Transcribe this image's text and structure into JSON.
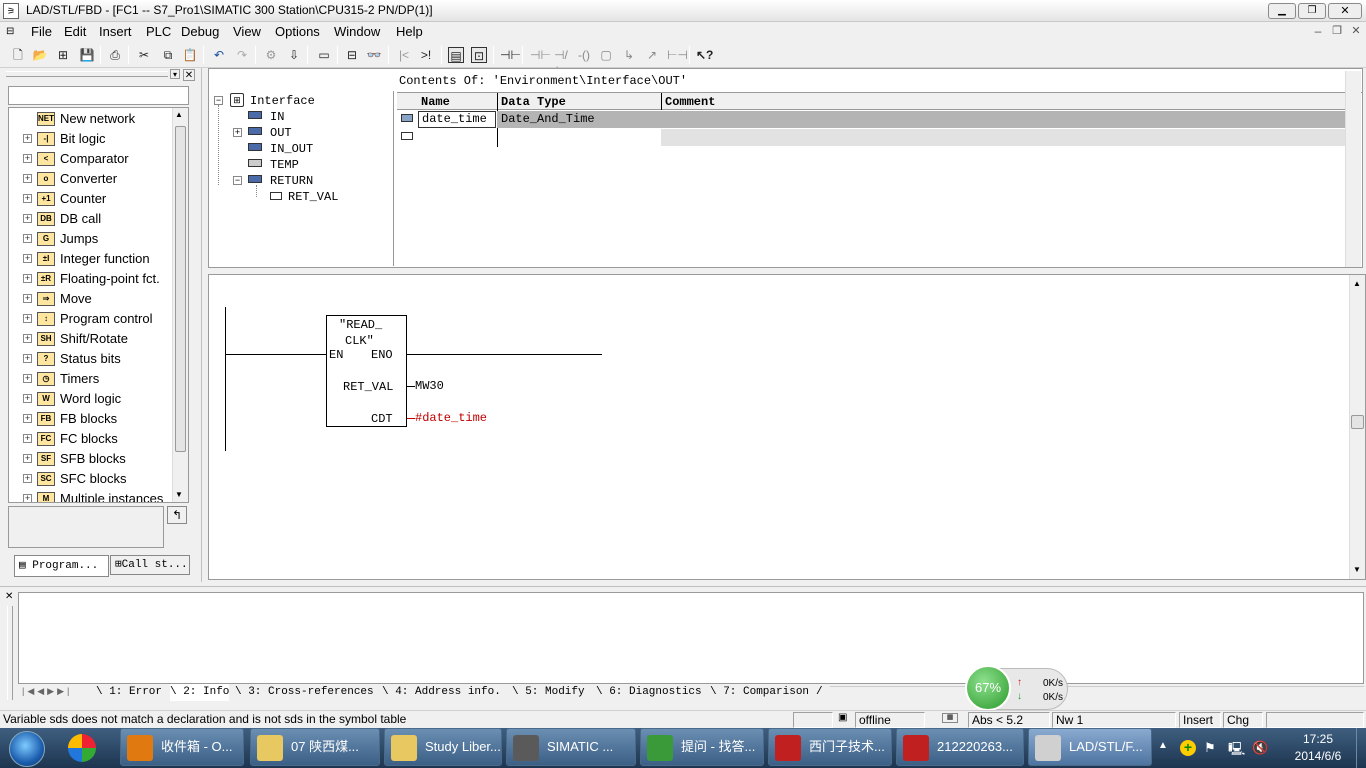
{
  "window": {
    "title": "LAD/STL/FBD  - [FC1 -- S7_Pro1\\SIMATIC 300 Station\\CPU315-2 PN/DP(1)]",
    "title_btns": [
      "▁",
      "❐",
      "✕"
    ],
    "mdi_btns": [
      "–",
      "❐",
      "✕"
    ]
  },
  "menu": [
    "File",
    "Edit",
    "Insert",
    "PLC",
    "Debug",
    "View",
    "Options",
    "Window",
    "Help"
  ],
  "catalog": {
    "items": [
      {
        "label": "New network",
        "icon": "NET"
      },
      {
        "label": "Bit logic",
        "icon": "-|"
      },
      {
        "label": "Comparator",
        "icon": "<"
      },
      {
        "label": "Converter",
        "icon": "o"
      },
      {
        "label": "Counter",
        "icon": "+1"
      },
      {
        "label": "DB call",
        "icon": "DB"
      },
      {
        "label": "Jumps",
        "icon": "G"
      },
      {
        "label": "Integer function",
        "icon": "±I"
      },
      {
        "label": "Floating-point fct.",
        "icon": "±R"
      },
      {
        "label": "Move",
        "icon": "⇒"
      },
      {
        "label": "Program control",
        "icon": "↕"
      },
      {
        "label": "Shift/Rotate",
        "icon": "SH"
      },
      {
        "label": "Status bits",
        "icon": "?"
      },
      {
        "label": "Timers",
        "icon": "◷"
      },
      {
        "label": "Word logic",
        "icon": "W"
      },
      {
        "label": "FB blocks",
        "icon": "FB"
      },
      {
        "label": "FC blocks",
        "icon": "FC"
      },
      {
        "label": "SFB blocks",
        "icon": "SF"
      },
      {
        "label": "SFC blocks",
        "icon": "SC"
      },
      {
        "label": "Multiple instances",
        "icon": "M"
      }
    ],
    "tabs": [
      "Program...",
      "Call st..."
    ]
  },
  "interface_tree": {
    "root": "Interface",
    "items": [
      "IN",
      "OUT",
      "IN_OUT",
      "TEMP",
      "RETURN",
      "RET_VAL"
    ]
  },
  "decl": {
    "contents_of": "Contents Of: 'Environment\\Interface\\OUT'",
    "columns": [
      "Name",
      "Data Type",
      "Comment"
    ],
    "rows": [
      {
        "name": "date_time",
        "type": "Date_And_Time",
        "comment": ""
      }
    ]
  },
  "network": {
    "block_name": "\"READ_\nCLK\"",
    "block_line1": "\"READ_",
    "block_line2": "CLK\"",
    "en": "EN",
    "eno": "ENO",
    "ret_val_pin": "RET_VAL",
    "ret_val_operand": "MW30",
    "cdt_pin": "CDT",
    "cdt_operand": "#date_time",
    "operand_color": "#c00000"
  },
  "output_tabs": [
    "1: Error",
    "2: Info",
    "3: Cross-references",
    "4: Address info.",
    "5: Modify",
    "6: Diagnostics",
    "7: Comparison"
  ],
  "net_monitor": {
    "percent": "67%",
    "up": "0K/s",
    "down": "0K/s"
  },
  "status": {
    "message": "Variable sds does not match a declaration and is not sds  in the symbol table",
    "mode": "offline",
    "abs": "Abs < 5.2",
    "nw": "Nw 1",
    "insert": "Insert",
    "chg": "Chg"
  },
  "taskbar": {
    "items": [
      "收件箱 - O...",
      "07 陕西煤...",
      "Study Liber...",
      "SIMATIC ...",
      "提问 - 找答...",
      "西门子技术...",
      "212220263...",
      "LAD/STL/F..."
    ],
    "time": "17:25",
    "date": "2014/6/6"
  }
}
